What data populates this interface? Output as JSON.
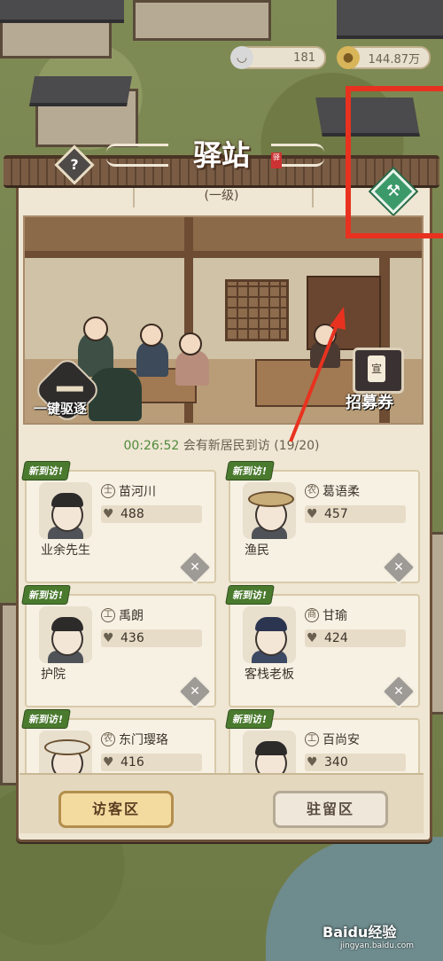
{
  "resources": {
    "bowls": "181",
    "coins": "144.87万"
  },
  "panel": {
    "title": "驿站",
    "seal": "驿",
    "level": "(一级)",
    "help_icon": "?",
    "upgrade_icon": "hammer-icon"
  },
  "scene": {
    "expel_label": "一键驱逐",
    "ticket_label": "招募券",
    "ticket_glyph": "宣"
  },
  "timer": {
    "time": "00:26:52",
    "text": "会有新居民到访",
    "count": "(19/20)"
  },
  "visitors": [
    {
      "tag": "新到访!",
      "badge": "士",
      "name": "苗河川",
      "stat": "488",
      "job": "业余先生"
    },
    {
      "tag": "新到访!",
      "badge": "农",
      "name": "葛语柔",
      "stat": "457",
      "job": "渔民"
    },
    {
      "tag": "新到访!",
      "badge": "工",
      "name": "禹朗",
      "stat": "436",
      "job": "护院"
    },
    {
      "tag": "新到访!",
      "badge": "商",
      "name": "甘瑜",
      "stat": "424",
      "job": "客栈老板"
    },
    {
      "tag": "新到访!",
      "badge": "农",
      "name": "东门璎珞",
      "stat": "416",
      "job": ""
    },
    {
      "tag": "新到访!",
      "badge": "工",
      "name": "百尚安",
      "stat": "340",
      "job": ""
    }
  ],
  "tabs": {
    "visitor_area": "访客区",
    "resident_area": "驻留区"
  },
  "watermark": {
    "brand": "Baidu经验",
    "url": "jingyan.baidu.com"
  },
  "colors": {
    "annotation": "#e8321f",
    "timer": "#4f8a3b",
    "new_tag": "#4a7a2e"
  }
}
